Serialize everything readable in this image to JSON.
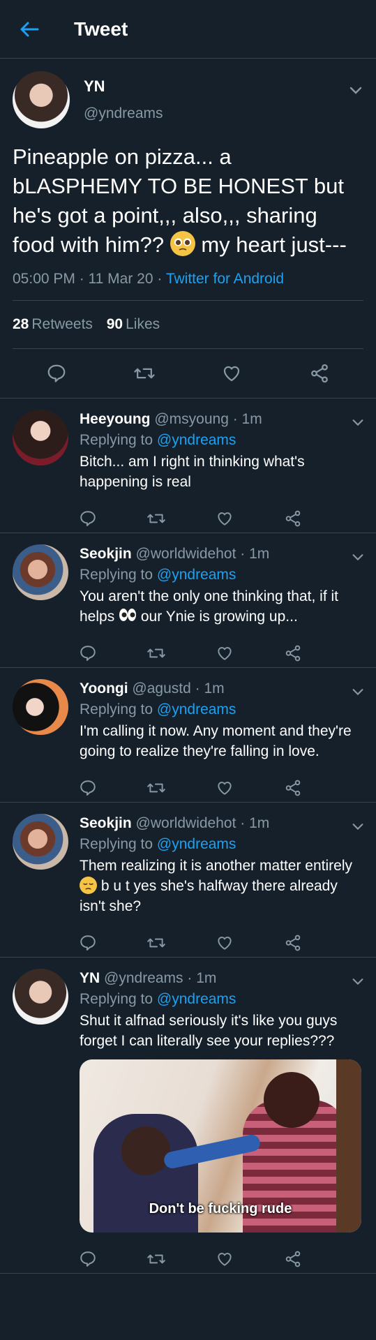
{
  "header": {
    "title": "Tweet"
  },
  "main_tweet": {
    "name": "YN",
    "handle": "@yndreams",
    "text_before_emoji": "Pineapple on pizza... a bLASPHEMY TO BE HONEST but he's got a point,,, also,,, sharing food with him?? ",
    "text_after_emoji": " my heart just---",
    "emoji": "pleading-face-emoji",
    "time": "05:00 PM · 11 Mar 20 · ",
    "source": "Twitter for Android",
    "retweets_count": "28",
    "retweets_label": "Retweets",
    "likes_count": "90",
    "likes_label": "Likes"
  },
  "replies": [
    {
      "name": "Heeyoung",
      "meta": " @msyoung · 1m",
      "replying_label": "Replying to ",
      "replying_handle": "@yndreams",
      "text": "Bitch... am I right in thinking what's happening is real"
    },
    {
      "name": "Seokjin",
      "meta": " @worldwidehot · 1m",
      "replying_label": "Replying to ",
      "replying_handle": "@yndreams",
      "text_before_emoji": "You aren't the only one thinking that, if it helps ",
      "emoji": "eyes-emoji",
      "text_after_emoji": " our Ynie is growing up..."
    },
    {
      "name": "Yoongi",
      "meta": " @agustd · 1m",
      "replying_label": "Replying to ",
      "replying_handle": "@yndreams",
      "text": "I'm calling it now. Any moment and they're going to realize they're falling in love."
    },
    {
      "name": "Seokjin",
      "meta": " @worldwidehot · 1m",
      "replying_label": "Replying to ",
      "replying_handle": "@yndreams",
      "text_before_emoji": "Them realizing it is another matter entirely ",
      "emoji": "pensive-face-emoji",
      "text_after_emoji": " b u t yes she's halfway there already isn't she?"
    },
    {
      "name": "YN",
      "meta": " @yndreams · 1m",
      "replying_label": "Replying to ",
      "replying_handle": "@yndreams",
      "text": "Shut it alfnad seriously it's like you guys forget I can literally see your replies???",
      "gif_caption": "Don't be fucking rude"
    }
  ],
  "colors": {
    "background": "#15202b",
    "accent": "#1da1f2",
    "muted": "#8899a6",
    "divider": "#38444d"
  }
}
